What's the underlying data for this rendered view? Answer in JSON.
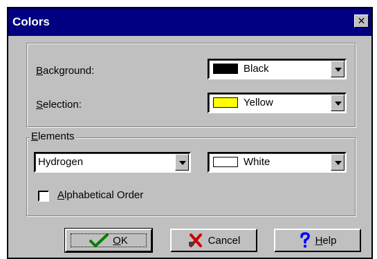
{
  "window": {
    "title": "Colors",
    "close_glyph": "✕"
  },
  "background": {
    "label_mnemonic": "B",
    "label_rest": "ackground:",
    "value": "Black",
    "swatch_color": "#000000"
  },
  "selection": {
    "label_mnemonic": "S",
    "label_rest": "election:",
    "value": "Yellow",
    "swatch_color": "#ffff00"
  },
  "elements": {
    "legend_mnemonic": "E",
    "legend_rest": "lements",
    "element_value": "Hydrogen",
    "color_value": "White",
    "swatch_color": "#ffffff",
    "alpha_mnemonic": "A",
    "alpha_rest": "lphabetical Order",
    "alpha_checked": false
  },
  "buttons": {
    "ok_mnemonic": "O",
    "ok_rest": "K",
    "ok_icon": "check-icon",
    "cancel_label": "Cancel",
    "cancel_icon": "cross-icon",
    "help_mnemonic": "H",
    "help_rest": "elp",
    "help_icon": "question-icon"
  },
  "colors": {
    "titlebar": "#000080",
    "face": "#c0c0c0",
    "check_green": "#008000",
    "cross_red": "#cc0000",
    "help_blue": "#0000ff"
  }
}
